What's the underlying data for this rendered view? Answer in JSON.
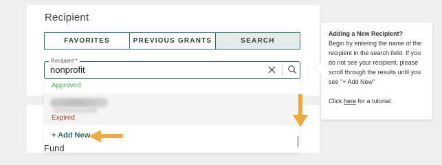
{
  "recipient_card": {
    "title": "Recipient",
    "tabs": [
      {
        "label": "FAVORITES"
      },
      {
        "label": "PREVIOUS GRANTS"
      },
      {
        "label": "SEARCH"
      }
    ],
    "active_tab": "SEARCH",
    "field": {
      "label": "Recipient *",
      "value": "nonprofit"
    },
    "dropdown": {
      "approved_status": "Approved",
      "expired_status": "Expired",
      "add_new": "+ Add New"
    }
  },
  "fund_card": {
    "title": "Fund"
  },
  "tooltip": {
    "title": "Adding a New Recipient?",
    "body": "Begin by entering the name of the recipient in the search field. If you do not see your recipient, please scroll through the results until you see \"+ Add New\"",
    "footer_prefix": "Click ",
    "footer_link": "here",
    "footer_suffix": " for a tutorial."
  },
  "colors": {
    "accent": "#2e6d63",
    "annotation_arrow": "#f0a93b",
    "approved": "#4caf50",
    "expired": "#a33a2a"
  },
  "icons": [
    "clear-icon",
    "search-icon",
    "arrow-down-annotation",
    "arrow-left-annotation"
  ]
}
